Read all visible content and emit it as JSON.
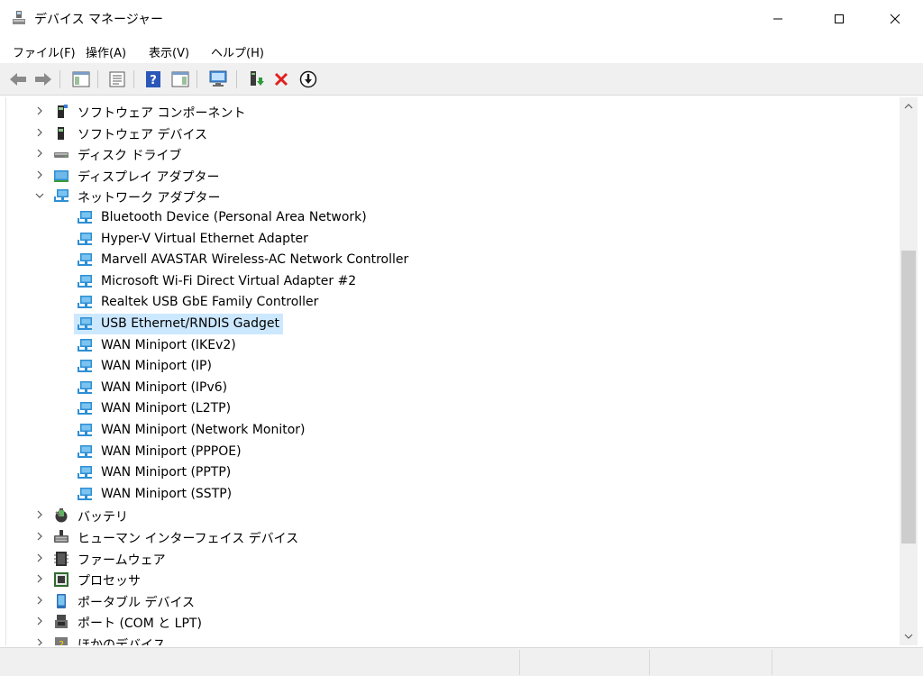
{
  "window": {
    "title": "デバイス マネージャー",
    "icons": {
      "app": "device-manager-icon",
      "minimize": "minimize-icon",
      "maximize": "maximize-icon",
      "close": "close-icon"
    }
  },
  "menu": {
    "file": "ファイル(F)",
    "action": "操作(A)",
    "view": "表示(V)",
    "help": "ヘルプ(H)"
  },
  "toolbar": {
    "buttons": [
      "back-arrow-icon",
      "forward-arrow-icon",
      "show-hide-tree-icon",
      "properties-icon",
      "help-icon",
      "action-pane-icon",
      "scan-hardware-icon",
      "update-driver-icon",
      "uninstall-device-icon",
      "disable-device-icon"
    ]
  },
  "tree": {
    "items": [
      {
        "label": "ソフトウェア コンポーネント",
        "level": 0,
        "expanded": false,
        "icon": "software-component-icon"
      },
      {
        "label": "ソフトウェア デバイス",
        "level": 0,
        "expanded": false,
        "icon": "software-device-icon"
      },
      {
        "label": "ディスク ドライブ",
        "level": 0,
        "expanded": false,
        "icon": "disk-drive-icon"
      },
      {
        "label": "ディスプレイ アダプター",
        "level": 0,
        "expanded": false,
        "icon": "display-adapter-icon"
      },
      {
        "label": "ネットワーク アダプター",
        "level": 0,
        "expanded": true,
        "icon": "network-adapter-icon"
      },
      {
        "label": "Bluetooth Device (Personal Area Network)",
        "level": 1,
        "icon": "network-adapter-icon"
      },
      {
        "label": "Hyper-V Virtual Ethernet Adapter",
        "level": 1,
        "icon": "network-adapter-icon"
      },
      {
        "label": "Marvell AVASTAR Wireless-AC Network Controller",
        "level": 1,
        "icon": "network-adapter-icon"
      },
      {
        "label": "Microsoft Wi-Fi Direct Virtual Adapter #2",
        "level": 1,
        "icon": "network-adapter-icon"
      },
      {
        "label": "Realtek USB GbE Family Controller",
        "level": 1,
        "icon": "network-adapter-icon"
      },
      {
        "label": "USB Ethernet/RNDIS Gadget",
        "level": 1,
        "icon": "network-adapter-icon",
        "selected": true
      },
      {
        "label": "WAN Miniport (IKEv2)",
        "level": 1,
        "icon": "network-adapter-icon"
      },
      {
        "label": "WAN Miniport (IP)",
        "level": 1,
        "icon": "network-adapter-icon"
      },
      {
        "label": "WAN Miniport (IPv6)",
        "level": 1,
        "icon": "network-adapter-icon"
      },
      {
        "label": "WAN Miniport (L2TP)",
        "level": 1,
        "icon": "network-adapter-icon"
      },
      {
        "label": "WAN Miniport (Network Monitor)",
        "level": 1,
        "icon": "network-adapter-icon"
      },
      {
        "label": "WAN Miniport (PPPOE)",
        "level": 1,
        "icon": "network-adapter-icon"
      },
      {
        "label": "WAN Miniport (PPTP)",
        "level": 1,
        "icon": "network-adapter-icon"
      },
      {
        "label": "WAN Miniport (SSTP)",
        "level": 1,
        "icon": "network-adapter-icon"
      },
      {
        "label": "バッテリ",
        "level": 0,
        "expanded": false,
        "icon": "battery-icon"
      },
      {
        "label": "ヒューマン インターフェイス デバイス",
        "level": 0,
        "expanded": false,
        "icon": "hid-icon"
      },
      {
        "label": "ファームウェア",
        "level": 0,
        "expanded": false,
        "icon": "firmware-icon"
      },
      {
        "label": "プロセッサ",
        "level": 0,
        "expanded": false,
        "icon": "processor-icon"
      },
      {
        "label": "ポータブル デバイス",
        "level": 0,
        "expanded": false,
        "icon": "portable-device-icon"
      },
      {
        "label": "ポート (COM と LPT)",
        "level": 0,
        "expanded": false,
        "icon": "port-icon"
      },
      {
        "label": "ほかのデバイス",
        "level": 0,
        "expanded": false,
        "icon": "other-device-icon"
      }
    ]
  },
  "colors": {
    "selection": "#cce8ff",
    "accent": "#0078d7",
    "close_red": "#e81123"
  }
}
